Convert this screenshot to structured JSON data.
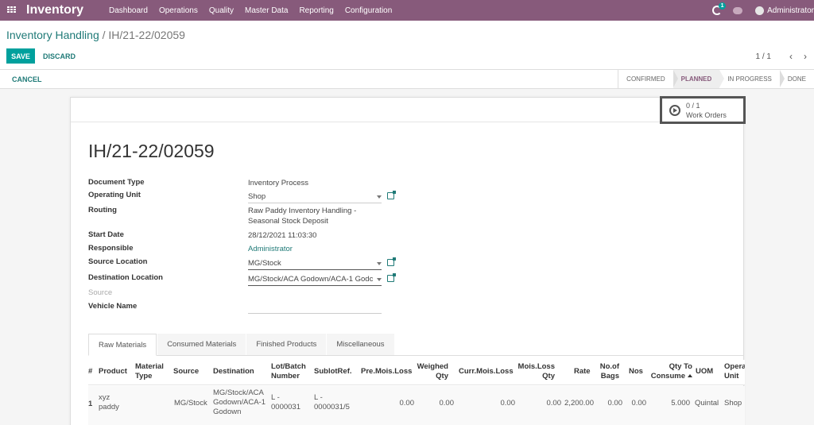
{
  "navbar": {
    "brand": "Inventory",
    "menu": [
      "Dashboard",
      "Operations",
      "Quality",
      "Master Data",
      "Reporting",
      "Configuration"
    ],
    "activity_count": "1",
    "user": "Administrator"
  },
  "breadcrumb": {
    "parent": "Inventory Handling",
    "separator": "/",
    "current": "IH/21-22/02059"
  },
  "toolbar": {
    "save_label": "SAVE",
    "discard_label": "DISCARD",
    "pager": "1 / 1",
    "prev_icon": "‹",
    "next_icon": "›"
  },
  "statusbar": {
    "cancel_label": "CANCEL",
    "stages": [
      "CONFIRMED",
      "PLANNED",
      "IN PROGRESS",
      "DONE"
    ],
    "active_stage": "PLANNED"
  },
  "smart_button": {
    "count": "0 / 1",
    "label": "Work Orders"
  },
  "record": {
    "title": "IH/21-22/02059",
    "fields": {
      "document_type": {
        "label": "Document Type",
        "value": "Inventory Process"
      },
      "operating_unit": {
        "label": "Operating Unit",
        "value": "Shop"
      },
      "routing": {
        "label": "Routing",
        "value_line1": "Raw Paddy Inventory Handling -",
        "value_line2": "Seasonal Stock Deposit"
      },
      "start_date": {
        "label": "Start Date",
        "value": "28/12/2021 11:03:30"
      },
      "responsible": {
        "label": "Responsible",
        "value": "Administrator"
      },
      "source_location": {
        "label": "Source Location",
        "value": "MG/Stock"
      },
      "destination_location": {
        "label": "Destination Location",
        "value": "MG/Stock/ACA Godown/ACA-1 Godc"
      },
      "source": {
        "label": "Source",
        "value": ""
      },
      "vehicle_name": {
        "label": "Vehicle Name",
        "value": ""
      }
    }
  },
  "tabs": [
    "Raw Materials",
    "Consumed Materials",
    "Finished Products",
    "Miscellaneous"
  ],
  "active_tab": "Raw Materials",
  "table": {
    "headers": {
      "num": "#",
      "product": "Product",
      "material_type_1": "Material",
      "material_type_2": "Type",
      "source": "Source",
      "destination": "Destination",
      "lot_1": "Lot/Batch",
      "lot_2": "Number",
      "sublot": "SublotRef.",
      "pre_mois": "Pre.Mois.Loss",
      "weighed_1": "Weighed",
      "weighed_2": "Qty",
      "curr_mois": "Curr.Mois.Loss",
      "mois_loss_1": "Mois.Loss",
      "mois_loss_2": "Qty",
      "rate": "Rate",
      "bags_1": "No.of",
      "bags_2": "Bags",
      "nos": "Nos",
      "qty_consume_1": "Qty To",
      "qty_consume_2": "Consume",
      "uom": "UOM",
      "op_unit_1": "Opera",
      "op_unit_2": "Unit"
    },
    "rows": [
      {
        "num": "1",
        "product_1": "xyz",
        "product_2": "paddy",
        "material_type": "",
        "source": "MG/Stock",
        "destination_1": "MG/Stock/ACA",
        "destination_2": "Godown/ACA-1",
        "destination_3": "Godown",
        "lot_1": "L -",
        "lot_2": "0000031",
        "sublot_1": "L -",
        "sublot_2": "0000031/5",
        "pre_mois": "0.00",
        "weighed": "0.00",
        "curr_mois": "0.00",
        "mois_loss": "0.00",
        "rate": "2,200.00",
        "bags": "0.00",
        "nos": "0.00",
        "qty_consume": "5.000",
        "uom": "Quintal",
        "op_unit": "Shop"
      }
    ]
  }
}
